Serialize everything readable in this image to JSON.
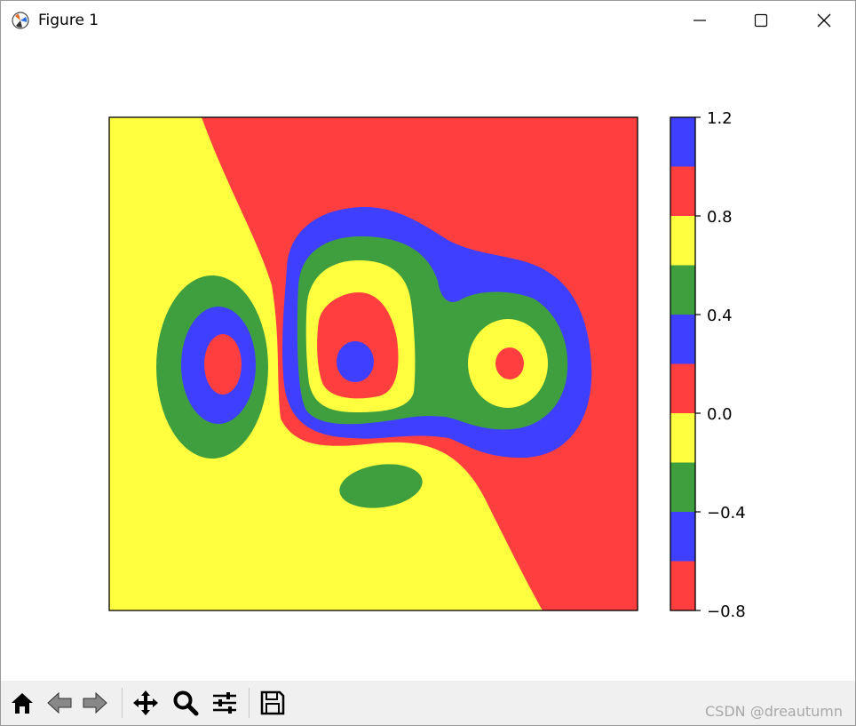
{
  "window": {
    "title": "Figure 1"
  },
  "titlebar_buttons": [
    "minimize",
    "maximize",
    "close"
  ],
  "colors": {
    "red": "#ff3f3f",
    "yellow": "#ffff3f",
    "green": "#3f9f3f",
    "blue": "#3f3fff"
  },
  "colorbar": {
    "tick_labels": [
      "1.2",
      "0.8",
      "0.4",
      "0.0",
      "−0.4",
      "−0.8"
    ],
    "levels": [
      -0.8,
      -0.6,
      -0.4,
      -0.2,
      0.0,
      0.2,
      0.4,
      0.6,
      0.8,
      1.0,
      1.2
    ]
  },
  "chart_data": {
    "type": "contour",
    "cmap_colors_cycle": [
      "#ff3f3f",
      "#3f3fff",
      "#3f9f3f",
      "#ffff3f"
    ],
    "colorbar_levels": [
      -0.8,
      -0.6,
      -0.4,
      -0.2,
      0.0,
      0.2,
      0.4,
      0.6,
      0.8,
      1.0,
      1.2
    ],
    "colorbar_tick_labels": [
      "1.2",
      "0.8",
      "0.4",
      "0.0",
      "−0.4",
      "−0.8"
    ],
    "axes_ticks": "none"
  },
  "toolbar": {
    "buttons": [
      "home-icon",
      "back-icon",
      "forward-icon",
      "pan-icon",
      "zoom-icon",
      "configure-subplots-icon",
      "save-icon"
    ]
  },
  "watermark": "CSDN @dreautumn"
}
